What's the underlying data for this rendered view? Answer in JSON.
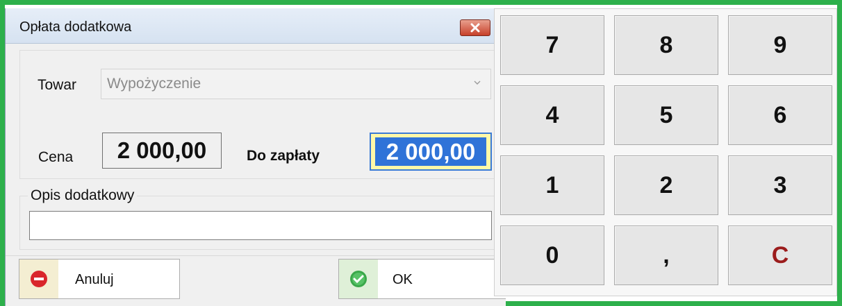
{
  "dialog": {
    "title": "Opłata dodatkowa",
    "towar_label": "Towar",
    "towar_value": "Wypożyczenie",
    "cena_label": "Cena",
    "cena_value": "2 000,00",
    "do_zaplaty_label": "Do zapłaty",
    "do_zaplaty_value": "2 000,00",
    "opis_label": "Opis dodatkowy",
    "opis_value": "",
    "cancel_label": "Anuluj",
    "ok_label": "OK"
  },
  "keypad": {
    "keys": [
      "7",
      "8",
      "9",
      "4",
      "5",
      "6",
      "1",
      "2",
      "3",
      "0",
      ",",
      "C"
    ]
  },
  "colors": {
    "frame": "#2db04b",
    "cancel_icon": "#d9262b",
    "ok_icon": "#3aa84a",
    "clear_key": "#9b1c1c",
    "highlight": "#2f73d8"
  },
  "icons": {
    "close": "close-icon",
    "dropdown": "chevron-down-icon",
    "cancel": "no-entry-icon",
    "ok": "check-circle-icon"
  }
}
